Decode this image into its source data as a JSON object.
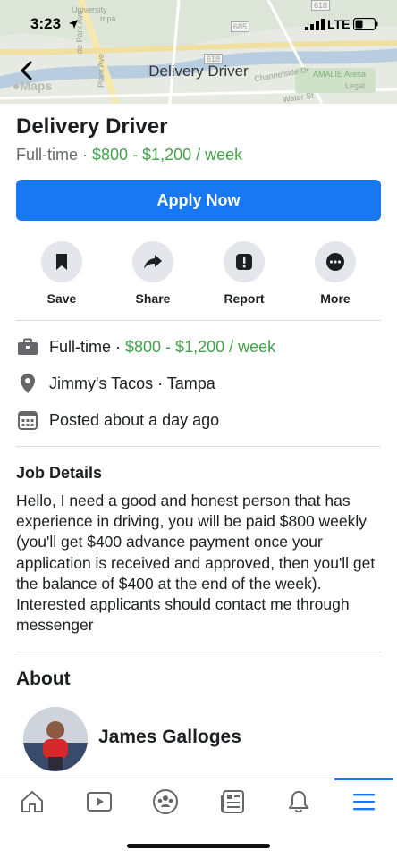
{
  "status_bar": {
    "time": "3:23",
    "network": "LTE"
  },
  "header": {
    "title": "Delivery Driver",
    "maps_label": "Maps",
    "map_labels": {
      "university": "University",
      "ampa": "mpa",
      "park_ave": "de Park Ave",
      "plant_ave": "Plant Ave",
      "route_685": "685",
      "route_618": "618",
      "top_route": "618",
      "channelside": "Channelside Dr",
      "amalie": "AMALIE Arena",
      "legal": "Legal",
      "water_st": "Water St"
    }
  },
  "job": {
    "title": "Delivery Driver",
    "type": "Full-time",
    "separator": " · ",
    "pay": "$800 - $1,200 / week",
    "apply_label": "Apply Now"
  },
  "actions": [
    {
      "label": "Save",
      "icon": "bookmark-icon"
    },
    {
      "label": "Share",
      "icon": "share-arrow-icon"
    },
    {
      "label": "Report",
      "icon": "report-icon"
    },
    {
      "label": "More",
      "icon": "more-dots-icon"
    }
  ],
  "info": {
    "employment_type": "Full-time",
    "separator": " · ",
    "pay": "$800 - $1,200 / week",
    "location": "Jimmy's Tacos · Tampa",
    "posted": "Posted about a day ago"
  },
  "details": {
    "heading": "Job Details",
    "body": "Hello, I need a good and honest person that has experience in driving, you will be paid $800 weekly (you'll get $400 advance payment once your application is received and approved, then you'll get the balance of $400 at the end of the week). Interested applicants should contact me through messenger"
  },
  "about": {
    "heading": "About",
    "name": "James Galloges"
  },
  "tabbar": {
    "tabs": [
      "home-icon",
      "video-icon",
      "groups-icon",
      "news-icon",
      "bell-icon",
      "menu-icon"
    ],
    "active": "menu-icon"
  },
  "colors": {
    "accent": "#1877f2",
    "pay_green": "#42a24a",
    "text": "#1c1e21",
    "secondary": "#65676b"
  }
}
